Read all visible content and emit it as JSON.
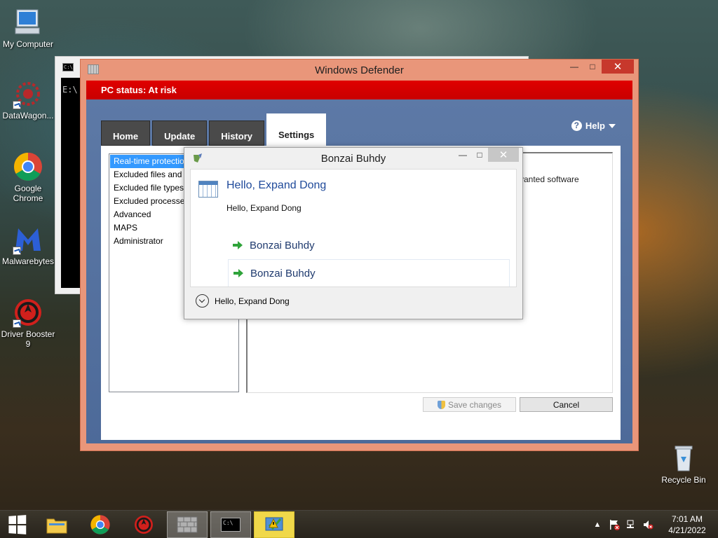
{
  "desktop": {
    "icons": [
      {
        "label": "My Computer"
      },
      {
        "label": "DataWagon..."
      },
      {
        "label": "Google Chrome"
      },
      {
        "label": "Malwarebytes"
      },
      {
        "label": "Driver Booster 9"
      },
      {
        "label": "Recycle Bin"
      }
    ]
  },
  "cmd": {
    "prompt": "E:\\",
    "icon_text": "C:\\"
  },
  "defender": {
    "title": "Windows Defender",
    "status": "PC status: At risk",
    "tabs": [
      {
        "label": "Home"
      },
      {
        "label": "Update"
      },
      {
        "label": "History"
      },
      {
        "label": "Settings"
      }
    ],
    "help_label": "Help",
    "settings_list": [
      "Real-time protection",
      "Excluded files and locations",
      "Excluded file types",
      "Excluded processes",
      "Advanced",
      "MAPS",
      "Administrator"
    ],
    "pane_text": "vanted software",
    "save_label": "Save changes",
    "cancel_label": "Cancel",
    "colors": {
      "frame": "#e9967a",
      "status_red": "#d40000",
      "client_blue": "#5572a2"
    }
  },
  "dialog": {
    "title": "Bonzai Buhdy",
    "heading": "Hello, Expand Dong",
    "subtext": "Hello, Expand Dong",
    "links": [
      {
        "label": "Bonzai Buhdy"
      },
      {
        "label": "Bonzai Buhdy"
      }
    ],
    "footer_text": "Hello, Expand Dong"
  },
  "taskbar": {
    "time": "7:01 AM",
    "date": "4/21/2022"
  }
}
